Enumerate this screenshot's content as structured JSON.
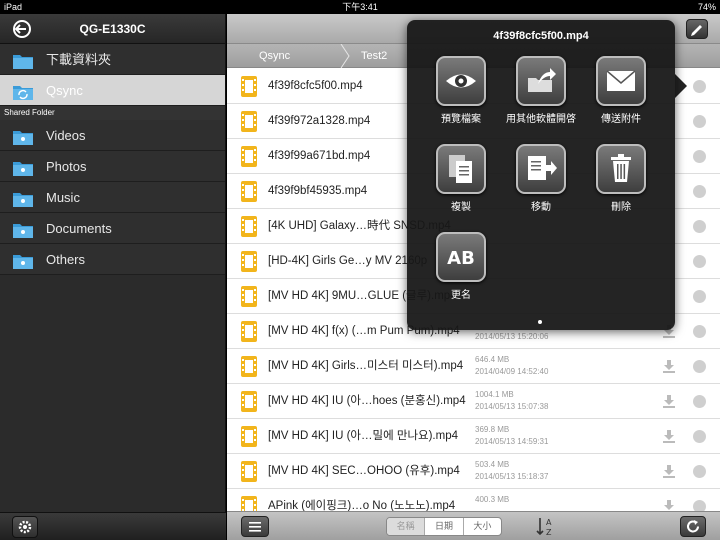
{
  "status_bar": {
    "device": "iPad",
    "time": "下午3:41",
    "battery": "74%"
  },
  "sidebar": {
    "title": "QG-E1330C",
    "top_items": [
      {
        "label": "下載資料夾"
      },
      {
        "label": "Qsync",
        "selected": true
      }
    ],
    "section_label": "Shared Folder",
    "folders": [
      {
        "label": "Videos"
      },
      {
        "label": "Photos"
      },
      {
        "label": "Music"
      },
      {
        "label": "Documents"
      },
      {
        "label": "Others"
      }
    ]
  },
  "breadcrumb": {
    "items": [
      "Qsync",
      "Test2"
    ]
  },
  "files": [
    {
      "name": "4f39f8cfc5f00.mp4",
      "size": "",
      "date": ""
    },
    {
      "name": "4f39f972a1328.mp4",
      "size": "",
      "date": ""
    },
    {
      "name": "4f39f99a671bd.mp4",
      "size": "",
      "date": ""
    },
    {
      "name": "4f39f9bf45935.mp4",
      "size": "",
      "date": ""
    },
    {
      "name": "[4K UHD] Galaxy…時代 SNSD.mp4",
      "size": "",
      "date": ""
    },
    {
      "name": "[HD-4K] Girls  Ge…y MV 2160p",
      "size": "",
      "date": ""
    },
    {
      "name": "[MV HD 4K] 9MU…GLUE (글루).mp4",
      "size": "",
      "date": ""
    },
    {
      "name": "[MV HD 4K] f(x) (…m Pum Pum).mp4",
      "size": "",
      "date": "2014/05/13 15:20:06"
    },
    {
      "name": "[MV HD 4K] Girls…미스터 미스터).mp4",
      "size": "646.4 MB",
      "date": "2014/04/09 14:52:40"
    },
    {
      "name": "[MV HD 4K] IU (아…hoes (분홍신).mp4",
      "size": "1004.1 MB",
      "date": "2014/05/13 15:07:38"
    },
    {
      "name": "[MV HD 4K] IU (아…밀에 만나요).mp4",
      "size": "369.8 MB",
      "date": "2014/05/13 14:59:31"
    },
    {
      "name": "[MV HD 4K] SEC…OHOO (유후).mp4",
      "size": "503.4 MB",
      "date": "2014/05/13 15:18:37"
    },
    {
      "name": "APink (에이핑크)…o No (노노노).mp4",
      "size": "400.3 MB",
      "date": ""
    }
  ],
  "bottom_bar": {
    "sort_options": [
      "名稱",
      "日期",
      "大小"
    ],
    "active_sort": "名稱"
  },
  "popover": {
    "title": "4f39f8cfc5f00.mp4",
    "actions": [
      {
        "label": "預覽檔案",
        "icon": "eye-icon"
      },
      {
        "label": "用其他軟體開啓",
        "icon": "open-in-icon"
      },
      {
        "label": "傳送附件",
        "icon": "envelope-icon"
      },
      {
        "label": "複製",
        "icon": "copy-icon"
      },
      {
        "label": "移動",
        "icon": "move-icon"
      },
      {
        "label": "刪除",
        "icon": "trash-icon"
      },
      {
        "label": "更名",
        "icon": "rename-icon",
        "glyph": "AB"
      }
    ]
  },
  "colors": {
    "file_icon": "#f2b51c",
    "folder_icon": "#3a9bd8",
    "popover_bg": "#161616"
  }
}
